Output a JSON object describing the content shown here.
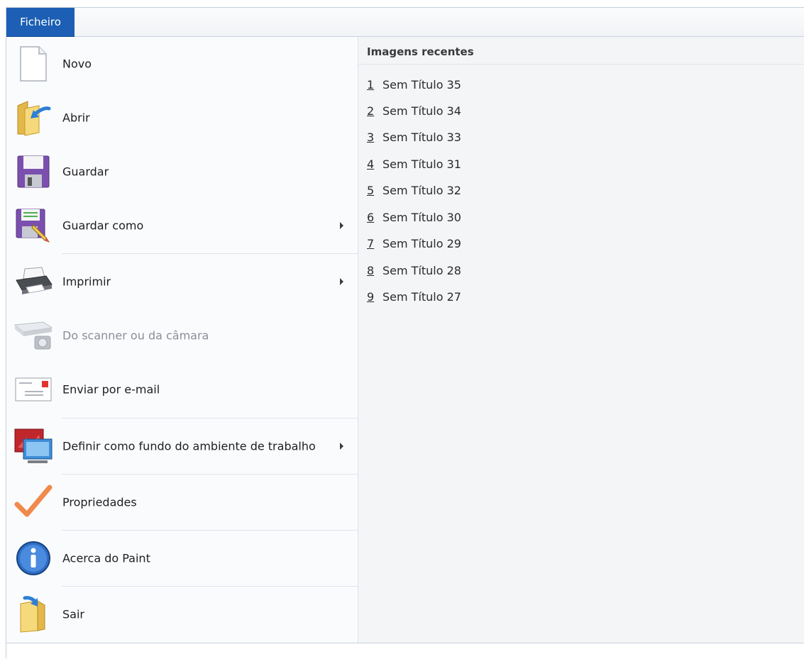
{
  "tab": {
    "label": "Ficheiro"
  },
  "menu": {
    "items": [
      {
        "label": "Novo",
        "icon": "new-document-icon",
        "submenu": false,
        "disabled": false
      },
      {
        "label": "Abrir",
        "icon": "open-folder-icon",
        "submenu": false,
        "disabled": false
      },
      {
        "label": "Guardar",
        "icon": "save-disk-icon",
        "submenu": false,
        "disabled": false
      },
      {
        "label": "Guardar como",
        "icon": "save-as-icon",
        "submenu": true,
        "disabled": false
      },
      {
        "label": "Imprimir",
        "icon": "printer-icon",
        "submenu": true,
        "disabled": false
      },
      {
        "label": "Do scanner ou da câmara",
        "icon": "scanner-camera-icon",
        "submenu": false,
        "disabled": true
      },
      {
        "label": "Enviar por e-mail",
        "icon": "email-envelope-icon",
        "submenu": false,
        "disabled": false
      },
      {
        "label": "Definir como fundo do ambiente de trabalho",
        "icon": "desktop-background-icon",
        "submenu": true,
        "disabled": false
      },
      {
        "label": "Propriedades",
        "icon": "checkmark-icon",
        "submenu": false,
        "disabled": false
      },
      {
        "label": "Acerca do Paint",
        "icon": "info-icon",
        "submenu": false,
        "disabled": false
      },
      {
        "label": "Sair",
        "icon": "exit-icon",
        "submenu": false,
        "disabled": false
      }
    ]
  },
  "recent": {
    "title": "Imagens recentes",
    "items": [
      {
        "num": "1",
        "name": "Sem Título 35"
      },
      {
        "num": "2",
        "name": "Sem Título 34"
      },
      {
        "num": "3",
        "name": "Sem Título 33"
      },
      {
        "num": "4",
        "name": "Sem Título 31"
      },
      {
        "num": "5",
        "name": "Sem Título 32"
      },
      {
        "num": "6",
        "name": "Sem Título 30"
      },
      {
        "num": "7",
        "name": "Sem Título 29"
      },
      {
        "num": "8",
        "name": "Sem Título 28"
      },
      {
        "num": "9",
        "name": "Sem Título 27"
      }
    ]
  },
  "colors": {
    "accent": "#1c5fb4",
    "disabled_text": "#8a8f96"
  }
}
